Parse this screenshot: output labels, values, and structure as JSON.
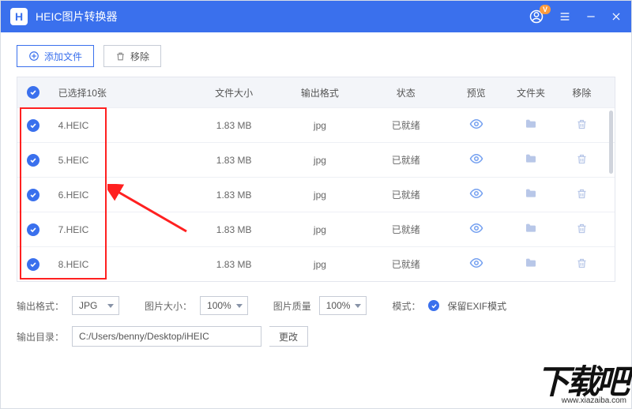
{
  "titlebar": {
    "logo_letter": "H",
    "title": "HEIC图片转换器",
    "user_badge": "V"
  },
  "toolbar": {
    "add_label": "添加文件",
    "remove_label": "移除"
  },
  "table": {
    "header": {
      "selected": "已选择10张",
      "size": "文件大小",
      "format": "输出格式",
      "status": "状态",
      "preview": "预览",
      "folder": "文件夹",
      "remove": "移除"
    },
    "rows": [
      {
        "name": "4.HEIC",
        "size": "1.83 MB",
        "format": "jpg",
        "status": "已就绪"
      },
      {
        "name": "5.HEIC",
        "size": "1.83 MB",
        "format": "jpg",
        "status": "已就绪"
      },
      {
        "name": "6.HEIC",
        "size": "1.83 MB",
        "format": "jpg",
        "status": "已就绪"
      },
      {
        "name": "7.HEIC",
        "size": "1.83 MB",
        "format": "jpg",
        "status": "已就绪"
      },
      {
        "name": "8.HEIC",
        "size": "1.83 MB",
        "format": "jpg",
        "status": "已就绪"
      }
    ]
  },
  "bottom": {
    "output_format_label": "输出格式：",
    "output_format_value": "JPG",
    "image_size_label": "图片大小：",
    "image_size_value": "100%",
    "image_quality_label": "图片质量",
    "image_quality_value": "100%",
    "mode_label": "模式：",
    "mode_text": "保留EXIF模式",
    "output_dir_label": "输出目录：",
    "output_dir_value": "C:/Users/benny/Desktop/iHEIC",
    "change_label": "更改"
  },
  "watermark": {
    "big": "下载吧",
    "url": "www.xiazaiba.com"
  }
}
